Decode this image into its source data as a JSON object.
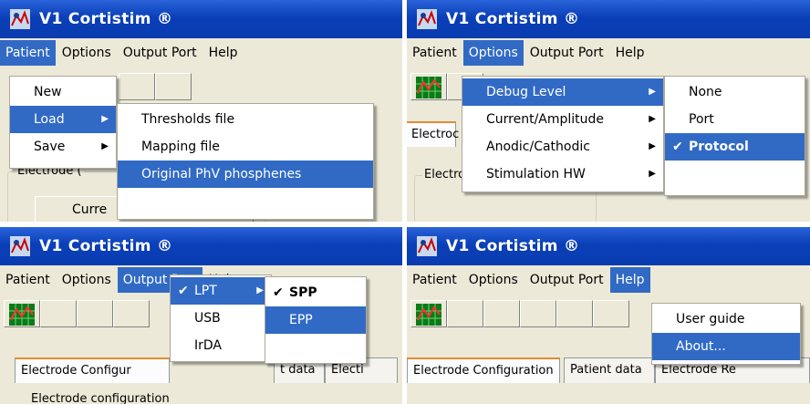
{
  "app": {
    "title": "V1 Cortistim ®"
  },
  "menubar": [
    "Patient",
    "Options",
    "Output Port",
    "Help"
  ],
  "panel1": {
    "patient_menu": [
      "New",
      "Load",
      "Save"
    ],
    "load_submenu": [
      "Thresholds file",
      "Mapping file",
      "Original PhV phosphenes"
    ],
    "groupbox_label": "Electrode (",
    "button_label": "Curre"
  },
  "panel2": {
    "options_menu": [
      "Debug Level",
      "Current/Amplitude",
      "Anodic/Cathodic",
      "Stimulation HW"
    ],
    "debug_submenu": [
      "None",
      "Port",
      "Protocol"
    ],
    "tab_label": "Electroc",
    "groupbox_label": "Electro"
  },
  "panel3": {
    "output_menu": [
      "LPT",
      "USB",
      "IrDA"
    ],
    "lpt_submenu": [
      "SPP",
      "EPP"
    ],
    "tabs": [
      "Electrode Configur",
      "t data",
      "Electi"
    ],
    "groupbox_label": "Electrode configuration"
  },
  "panel4": {
    "help_menu": [
      "User guide",
      "About..."
    ],
    "tabs": [
      "Electrode Configuration",
      "Patient data",
      "Electrode Re"
    ]
  },
  "icons": {
    "app": "cortistim-app-icon",
    "chart": "grid-chart-icon",
    "check": "checkmark-icon",
    "arrow": "submenu-arrow-icon"
  },
  "colors": {
    "titlebar": "#0a3fb8",
    "highlight": "#316ac5",
    "face": "#ece9d8"
  }
}
